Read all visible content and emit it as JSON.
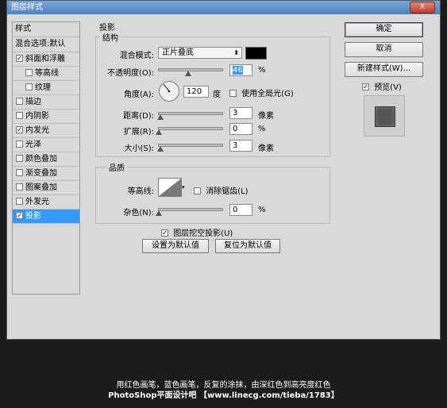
{
  "window": {
    "title": "图层样式",
    "close_label": "X"
  },
  "left_panel": {
    "header": "样式",
    "blend": "混合选项:默认",
    "items": [
      {
        "label": "斜面和浮雕",
        "checked": true,
        "indent": false,
        "selected": false
      },
      {
        "label": "等高线",
        "checked": false,
        "indent": true,
        "selected": false
      },
      {
        "label": "纹理",
        "checked": false,
        "indent": true,
        "selected": false
      },
      {
        "label": "描边",
        "checked": false,
        "indent": false,
        "selected": false
      },
      {
        "label": "内阴影",
        "checked": false,
        "indent": false,
        "selected": false
      },
      {
        "label": "内发光",
        "checked": true,
        "indent": false,
        "selected": false
      },
      {
        "label": "光泽",
        "checked": false,
        "indent": false,
        "selected": false
      },
      {
        "label": "颜色叠加",
        "checked": false,
        "indent": false,
        "selected": false
      },
      {
        "label": "渐变叠加",
        "checked": false,
        "indent": false,
        "selected": false
      },
      {
        "label": "图案叠加",
        "checked": false,
        "indent": false,
        "selected": false
      },
      {
        "label": "外发光",
        "checked": false,
        "indent": false,
        "selected": false
      },
      {
        "label": "投影",
        "checked": true,
        "indent": false,
        "selected": true
      }
    ]
  },
  "shadow": {
    "section_title": "投影",
    "structure": {
      "title": "结构",
      "blend_mode_label": "混合模式:",
      "blend_mode_value": "正片叠底",
      "shadow_color": "#000000",
      "opacity_label": "不透明度(O):",
      "opacity_value": "46",
      "opacity_unit": "%",
      "opacity_level": 0.46,
      "angle_label": "角度(A):",
      "angle_value": "120",
      "angle_unit": "度",
      "global_light_label": "使用全局光(G)",
      "global_light_checked": false,
      "distance_label": "距离(D):",
      "distance_value": "3",
      "distance_unit": "像素",
      "spread_label": "扩展(R):",
      "spread_value": "0",
      "spread_unit": "%",
      "size_label": "大小(S):",
      "size_value": "3",
      "size_unit": "像素"
    },
    "quality": {
      "title": "品质",
      "contour_label": "等高线:",
      "antialias_label": "消除锯齿(L)",
      "antialias_checked": false,
      "noise_label": "杂色(N):",
      "noise_value": "0",
      "noise_unit": "%"
    },
    "knockout_label": "图层挖空投影(U)",
    "knockout_checked": true,
    "make_default_label": "设置为默认值",
    "reset_default_label": "复位为默认值"
  },
  "right_buttons": {
    "ok": "确定",
    "cancel": "取消",
    "new_style": "新建样式(W)...",
    "preview_label": "预览(V)",
    "preview_checked": true
  },
  "captions": {
    "line1": "用红色画笔，蓝色画笔，反复的涂抹，由深红色到高亮度红色",
    "line2": "PhotoShop平面设计吧 【www.linecg.com/tieba/1783】"
  }
}
